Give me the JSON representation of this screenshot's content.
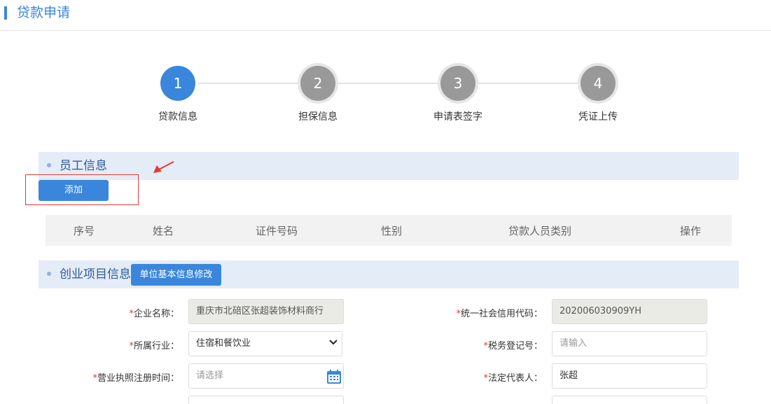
{
  "header": {
    "title": "贷款申请"
  },
  "steps": [
    {
      "number": "1",
      "label": "贷款信息",
      "active": true
    },
    {
      "number": "2",
      "label": "担保信息",
      "active": false
    },
    {
      "number": "3",
      "label": "申请表签字",
      "active": false
    },
    {
      "number": "4",
      "label": "凭证上传",
      "active": false
    }
  ],
  "employee": {
    "title": "员工信息",
    "add_button": "添加",
    "columns": [
      "序号",
      "姓名",
      "证件号码",
      "性别",
      "贷款人员类别",
      "操作"
    ]
  },
  "project": {
    "title": "创业项目信息",
    "edit_button": "单位基本信息修改",
    "fields": {
      "company_name": {
        "label": "企业名称：",
        "value": "重庆市北碚区张超装饰材料商行"
      },
      "credit_code": {
        "label": "统一社会信用代码：",
        "value": "202006030909YH"
      },
      "industry": {
        "label": "所属行业：",
        "value": "住宿和餐饮业"
      },
      "tax_reg": {
        "label": "税务登记号：",
        "placeholder": "请输入"
      },
      "license_date": {
        "label": "营业执照注册时间：",
        "placeholder": "请选择"
      },
      "legal_rep": {
        "label": "法定代表人：",
        "value": "张超"
      }
    }
  },
  "colors": {
    "accent": "#3a86dc",
    "section_bg": "#e4ecf7",
    "required": "#e53935",
    "annotation": "#e53935"
  }
}
